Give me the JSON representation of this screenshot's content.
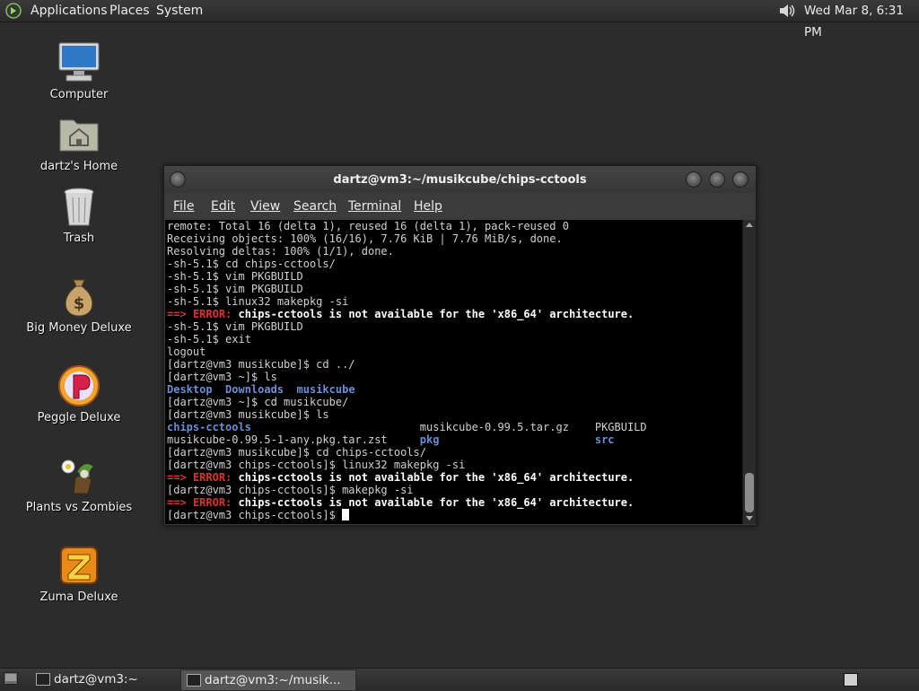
{
  "top_panel": {
    "applications": "Applications",
    "places": "Places",
    "system": "System",
    "clock": "Wed Mar  8,  6:31 PM"
  },
  "desktop_icons": [
    {
      "label": "Computer",
      "icon": "computer-icon"
    },
    {
      "label": "dartz's Home",
      "icon": "home-folder-icon"
    },
    {
      "label": "Trash",
      "icon": "trash-icon"
    },
    {
      "label": "Big Money Deluxe",
      "icon": "money-bag-icon"
    },
    {
      "label": "Peggle Deluxe",
      "icon": "peggle-icon"
    },
    {
      "label": "Plants vs Zombies",
      "icon": "plants-vs-zombies-icon"
    },
    {
      "label": "Zuma Deluxe",
      "icon": "zuma-icon"
    }
  ],
  "terminal": {
    "title": "dartz@vm3:~/musikcube/chips-cctools",
    "menu": {
      "file": "File",
      "edit": "Edit",
      "view": "View",
      "search": "Search",
      "terminal": "Terminal",
      "help": "Help"
    },
    "lines": [
      {
        "text": "remote: Total 16 (delta 1), reused 16 (delta 1), pack-reused 0"
      },
      {
        "text": "Receiving objects: 100% (16/16), 7.76 KiB | 7.76 MiB/s, done."
      },
      {
        "text": "Resolving deltas: 100% (1/1), done."
      },
      {
        "text": "-sh-5.1$ cd chips-cctools/"
      },
      {
        "text": "-sh-5.1$ vim PKGBUILD"
      },
      {
        "text": "-sh-5.1$ vim PKGBUILD"
      },
      {
        "text": "-sh-5.1$ linux32 makepkg -si"
      },
      {
        "arrow": "==>",
        "error": "ERROR:",
        "message": "chips-cctools is not available for the 'x86_64' architecture."
      },
      {
        "text": "-sh-5.1$ vim PKGBUILD"
      },
      {
        "text": "-sh-5.1$ exit"
      },
      {
        "text": "logout"
      },
      {
        "text": "[dartz@vm3 musikcube]$ cd ../"
      },
      {
        "text": "[dartz@vm3 ~]$ ls"
      },
      {
        "dirs": [
          "Desktop",
          "Downloads",
          "musikcube"
        ]
      },
      {
        "text": "[dartz@vm3 ~]$ cd musikcube/"
      },
      {
        "text": "[dartz@vm3 musikcube]$ ls"
      },
      {
        "ls_cols": [
          "chips-cctools",
          "musikcube-0.99.5.tar.gz",
          "PKGBUILD"
        ],
        "ls_dir_flags": [
          true,
          false,
          false
        ]
      },
      {
        "ls_cols": [
          "musikcube-0.99.5-1-any.pkg.tar.zst",
          "pkg",
          "src"
        ],
        "ls_dir_flags": [
          false,
          true,
          true
        ]
      },
      {
        "text": "[dartz@vm3 musikcube]$ cd chips-cctools/"
      },
      {
        "text": "[dartz@vm3 chips-cctools]$ linux32 makepkg -si"
      },
      {
        "arrow": "==>",
        "error": "ERROR:",
        "message": "chips-cctools is not available for the 'x86_64' architecture."
      },
      {
        "text": "[dartz@vm3 chips-cctools]$ makepkg -si"
      },
      {
        "arrow": "==>",
        "error": "ERROR:",
        "message": "chips-cctools is not available for the 'x86_64' architecture."
      },
      {
        "text": "[dartz@vm3 chips-cctools]$ ",
        "cursor": true
      }
    ],
    "scroll_position": 0.95
  },
  "bottom_panel": {
    "tasks": [
      {
        "label": "dartz@vm3:~",
        "active": false
      },
      {
        "label": "dartz@vm3:~/musik...",
        "active": true
      }
    ]
  }
}
